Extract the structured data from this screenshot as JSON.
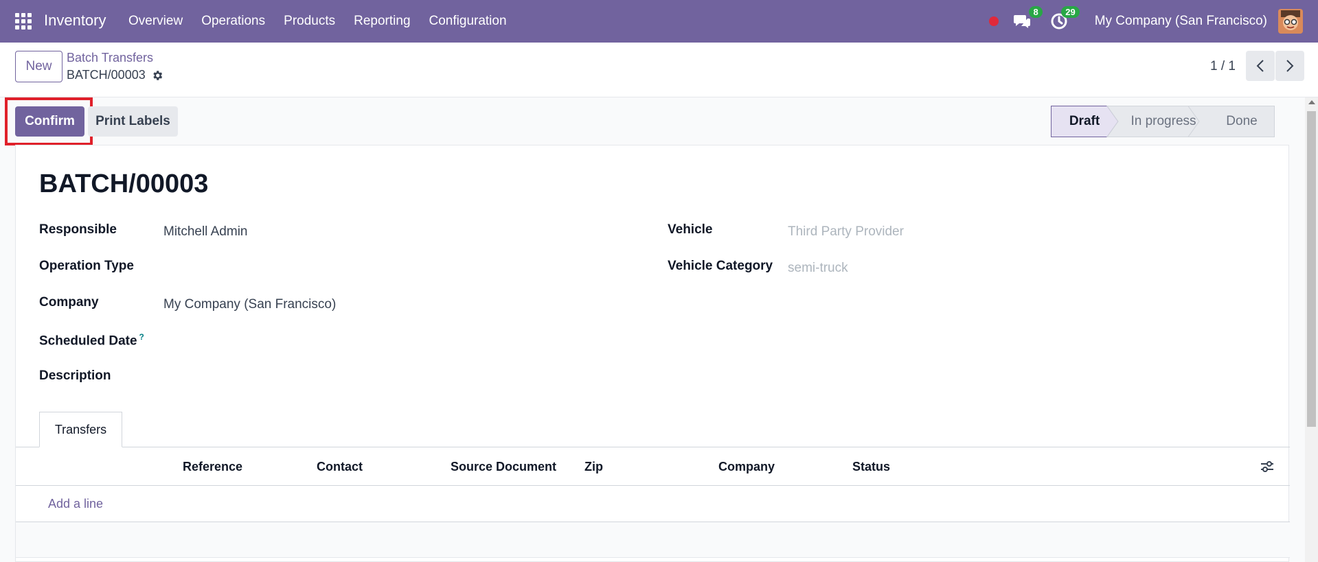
{
  "navbar": {
    "brand": "Inventory",
    "menu": [
      "Overview",
      "Operations",
      "Products",
      "Reporting",
      "Configuration"
    ],
    "messages_count": "8",
    "activities_count": "29",
    "company": "My Company (San Francisco)"
  },
  "control_panel": {
    "new_label": "New",
    "breadcrumb_parent": "Batch Transfers",
    "breadcrumb_current": "BATCH/00003",
    "pager": "1 / 1"
  },
  "actions": {
    "confirm_label": "Confirm",
    "print_labels_label": "Print Labels"
  },
  "statusbar": {
    "stages": [
      "Draft",
      "In progress",
      "Done"
    ],
    "active": "Draft"
  },
  "form": {
    "title": "BATCH/00003",
    "fields_left": [
      {
        "label": "Responsible",
        "value": "Mitchell Admin"
      },
      {
        "label": "Operation Type",
        "value": ""
      },
      {
        "label": "Company",
        "value": "My Company (San Francisco)"
      },
      {
        "label": "Scheduled Date",
        "value": "",
        "help": "?"
      },
      {
        "label": "Description",
        "value": ""
      }
    ],
    "fields_right": [
      {
        "label": "Vehicle",
        "placeholder": "Third Party Provider"
      },
      {
        "label": "Vehicle Category",
        "placeholder": "semi-truck"
      }
    ]
  },
  "tabs": {
    "active": "Transfers"
  },
  "list": {
    "columns": [
      "Reference",
      "Contact",
      "Source Document",
      "Zip",
      "Company",
      "Status"
    ],
    "add_line": "Add a line"
  },
  "colors": {
    "brand": "#71639e",
    "highlight": "#e0202a",
    "badge": "#28a745"
  }
}
